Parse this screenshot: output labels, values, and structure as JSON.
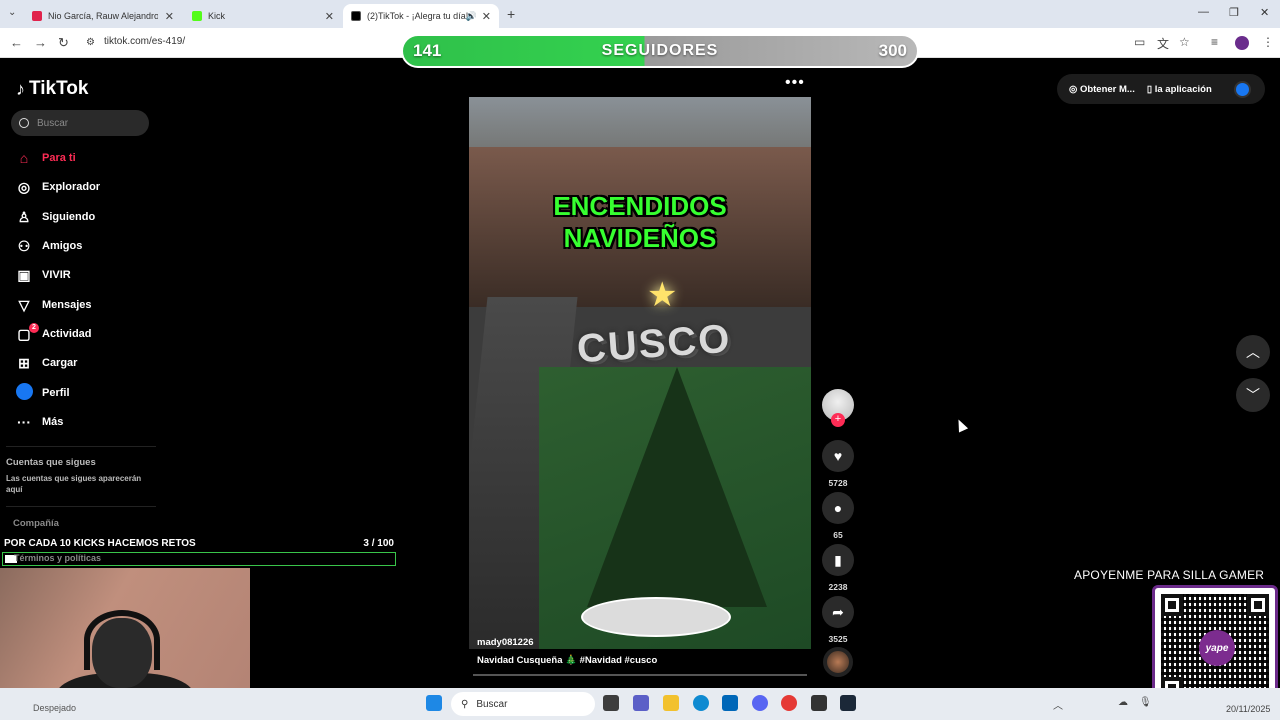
{
  "browser": {
    "tabs": [
      {
        "label": "Nio García, Rauw Alejandro, Le",
        "fav_color": "#e0224b"
      },
      {
        "label": "Kick",
        "fav_color": "#53fc18"
      },
      {
        "label": "(2)TikTok - ¡Alegra tu día!",
        "fav_color": "#000000"
      }
    ],
    "new_tab": "+",
    "url": "tiktok.com/es-419/",
    "window_controls": [
      "—",
      "❐",
      "✕"
    ]
  },
  "overlay": {
    "current": "141",
    "label": "SEGUIDORES",
    "goal": "300",
    "progress": 0.47
  },
  "sidebar": {
    "brand": "TikTok",
    "search_placeholder": "Buscar",
    "items": [
      {
        "label": "Para ti",
        "icon": "home-icon",
        "glyph": "⌂"
      },
      {
        "label": "Explorador",
        "icon": "compass-icon",
        "glyph": "◎"
      },
      {
        "label": "Siguiendo",
        "icon": "following-icon",
        "glyph": "♙"
      },
      {
        "label": "Amigos",
        "icon": "friends-icon",
        "glyph": "⚇"
      },
      {
        "label": "VIVIR",
        "icon": "live-icon",
        "glyph": "▣"
      },
      {
        "label": "Mensajes",
        "icon": "messages-icon",
        "glyph": "▽"
      },
      {
        "label": "Actividad",
        "icon": "activity-icon",
        "glyph": "▢",
        "badge": "2"
      },
      {
        "label": "Cargar",
        "icon": "upload-icon",
        "glyph": "⊞"
      },
      {
        "label": "Perfil",
        "icon": "profile-icon",
        "glyph": ""
      },
      {
        "label": "Más",
        "icon": "more-icon",
        "glyph": "···"
      }
    ],
    "following_title": "Cuentas que sigues",
    "following_note": "Las cuentas que sigues aparecerán aquí",
    "company": "Compañía",
    "terms": "Términos y políticas"
  },
  "video": {
    "headline_1": "ENCENDIDOS",
    "headline_2": "NAVIDEÑOS",
    "place": "CUSCO",
    "author": "mady081226",
    "caption": "Navidad Cusqueña 🎄 #Navidad #cusco"
  },
  "actions": {
    "likes": "5728",
    "comments": "65",
    "saves": "2238",
    "shares": "3525"
  },
  "topright": {
    "get_more": "Obtener M...",
    "app": "la aplicación"
  },
  "stream": {
    "kicks_label": "POR CADA 10 KICKS HACEMOS RETOS",
    "kicks_count": "3   / 100",
    "kicks_progress": 0.03,
    "support_text": "APOYENME PARA SILLA GAMER",
    "qr_brand": "yape"
  },
  "taskbar": {
    "search_placeholder": "Buscar",
    "weather": "Despejado",
    "date": "20/11/2025"
  }
}
